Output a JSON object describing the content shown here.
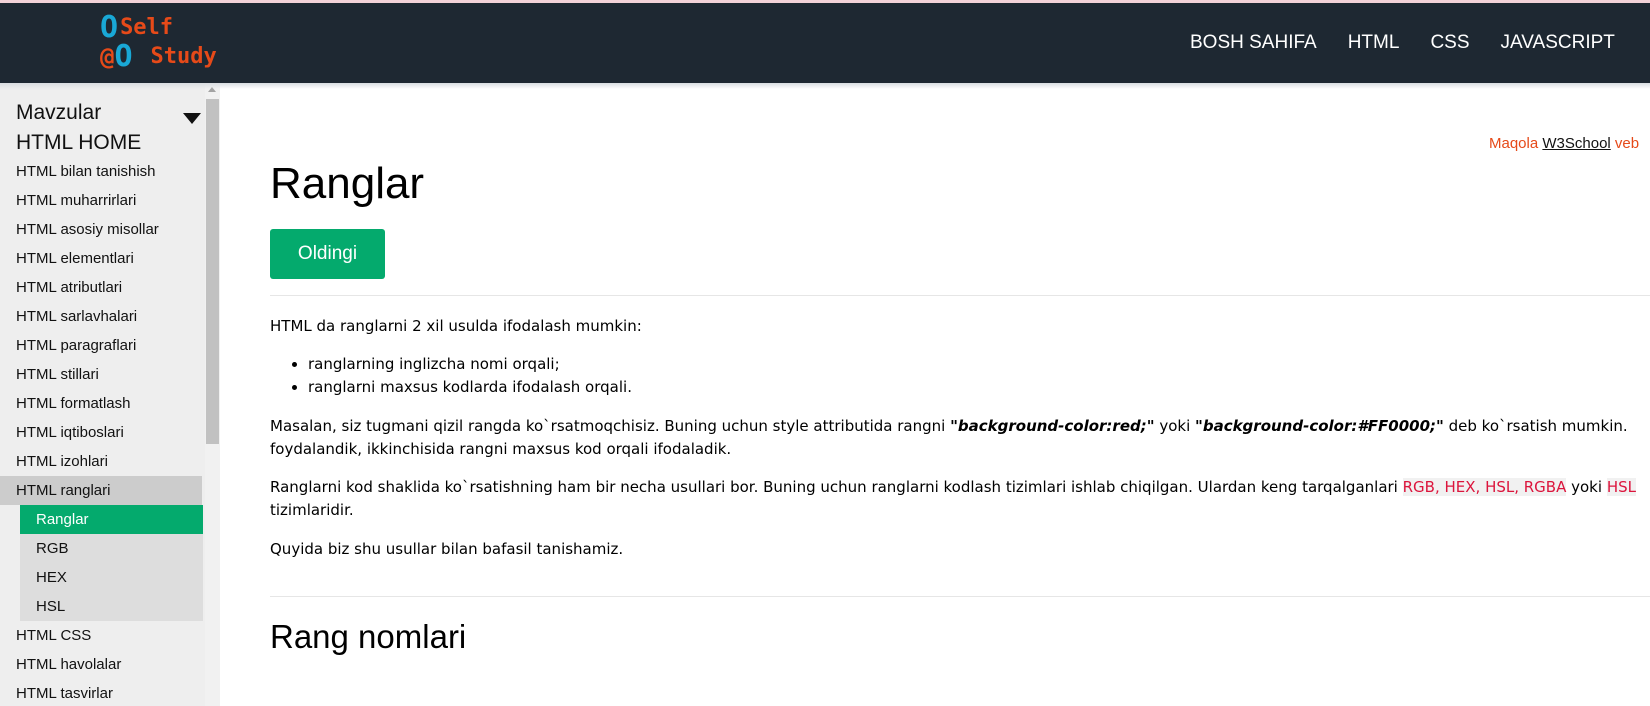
{
  "logo": {
    "line1_mark": "O",
    "line1_text": "Self",
    "line2_at": "@",
    "line2_mark": "O",
    "line2_text": "Study"
  },
  "nav": {
    "links": [
      "BOSH SAHIFA",
      "HTML",
      "CSS",
      "JAVASCRIPT"
    ]
  },
  "sidebar": {
    "topics_label": "Mavzular",
    "home_label": "HTML HOME",
    "items": [
      "HTML bilan tanishish",
      "HTML muharrirlari",
      "HTML asosiy misollar",
      "HTML elementlari",
      "HTML atributlari",
      "HTML sarlavhalari",
      "HTML paragraflari",
      "HTML stillari",
      "HTML formatlash",
      "HTML iqtiboslari",
      "HTML izohlari",
      "HTML ranglari"
    ],
    "sub_items": [
      "Ranglar",
      "RGB",
      "HEX",
      "HSL"
    ],
    "after_items": [
      "HTML CSS",
      "HTML havolalar",
      "HTML tasvirlar"
    ]
  },
  "main": {
    "credit_prefix": "Maqola",
    "credit_link": "W3School",
    "credit_suffix": "veb",
    "title": "Ranglar",
    "prev_button": "Oldingi",
    "intro": "HTML da ranglarni 2 xil usulda ifodalash mumkin:",
    "bullets": [
      "ranglarning inglizcha nomi orqali;",
      "ranglarni maxsus kodlarda ifodalash orqali."
    ],
    "p2_a": "Masalan, siz tugmani qizil rangda ko`rsatmoqchisiz. Buning uchun style attributida rangni ",
    "p2_code1": "\"background-color:red;\"",
    "p2_b": " yoki ",
    "p2_code2": "\"background-color:#FF0000;\"",
    "p2_c": " deb ko`rsatish mumkin.",
    "p2_line2": "foydalandik, ikkinchisida rangni maxsus kod orqali ifodaladik.",
    "p3_a": "Ranglarni kod shaklida ko`rsatishning ham bir necha usullari bor. Buning uchun ranglarni kodlash tizimlari ishlab chiqilgan. Ulardan keng tarqalganlari ",
    "p3_hl1": "RGB, HEX, HSL, RGBA",
    "p3_b": " yoki ",
    "p3_hl2": "HSL",
    "p3_line2": "tizimlaridir.",
    "p4": "Quyida biz shu usullar bilan bafasil tanishamiz.",
    "section_title": "Rang nomlari"
  },
  "colors": {
    "navbar_bg": "#1e2832",
    "accent_green": "#04aa6d",
    "logo_blue": "#19a8d6",
    "logo_orange": "#e64a19",
    "highlight_red": "#dc143c"
  }
}
